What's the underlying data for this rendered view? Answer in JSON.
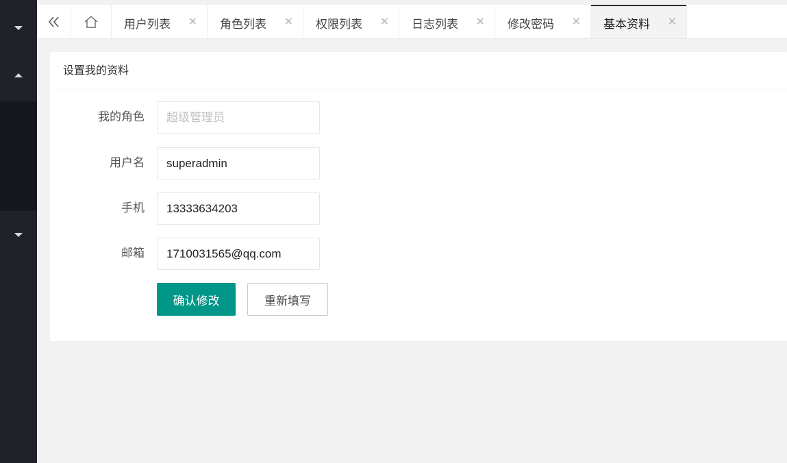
{
  "sidebar": {
    "items": [
      {
        "icon": "caret-down-icon"
      },
      {
        "icon": "caret-up-icon"
      },
      {
        "icon": "caret-down-icon"
      }
    ]
  },
  "tabs": {
    "nav_icon": "double-chevron-left-icon",
    "home_icon": "home-icon",
    "close_glyph": "×",
    "items": [
      {
        "label": "用户列表",
        "active": false
      },
      {
        "label": "角色列表",
        "active": false
      },
      {
        "label": "权限列表",
        "active": false
      },
      {
        "label": "日志列表",
        "active": false
      },
      {
        "label": "修改密码",
        "active": false
      },
      {
        "label": "基本资料",
        "active": true
      }
    ]
  },
  "card": {
    "title": "设置我的资料"
  },
  "form": {
    "role": {
      "label": "我的角色",
      "value": "",
      "placeholder": "超级管理员"
    },
    "username": {
      "label": "用户名",
      "value": "superadmin"
    },
    "phone": {
      "label": "手机",
      "value": "13333634203"
    },
    "email": {
      "label": "邮箱",
      "value": "1710031565@qq.com"
    },
    "submit_label": "确认修改",
    "reset_label": "重新填写"
  },
  "colors": {
    "primary": "#009688",
    "sidebar_bg": "#20222a"
  }
}
